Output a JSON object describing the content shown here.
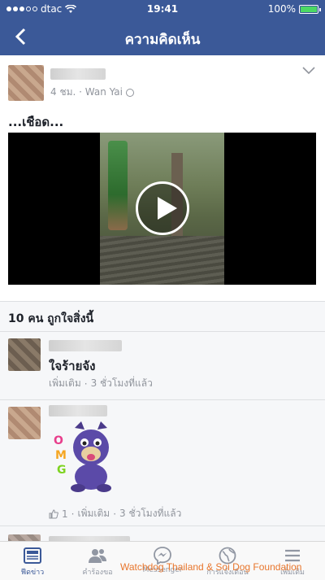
{
  "status": {
    "carrier": "dtac",
    "time": "19:41",
    "battery": "100%"
  },
  "nav": {
    "title": "ความคิดเห็น"
  },
  "post": {
    "meta": "4 ชม. · Wan Yai",
    "caption": "...เชือด..."
  },
  "likes": {
    "text": "10 คน ถูกใจสิ่งนี้"
  },
  "comments": [
    {
      "text": "ใจร้ายจัง",
      "more": "เพิ่มเติม",
      "time": "3 ชั่วโมงที่แล้ว"
    },
    {
      "like_count": "1",
      "more": "เพิ่มเติม",
      "time": "3 ชั่วโมงที่แล้ว"
    }
  ],
  "tabs": [
    {
      "label": "ฟีดข่าว"
    },
    {
      "label": "คำร้องขอ"
    },
    {
      "label": "Messenger"
    },
    {
      "label": "การแจ้งเตือน"
    },
    {
      "label": "เพิ่มเติม"
    }
  ],
  "watermark": "Watchdog Thailand & Soi Dog Foundation",
  "colors": {
    "brand": "#3b5998",
    "watermark": "#e8762d"
  }
}
